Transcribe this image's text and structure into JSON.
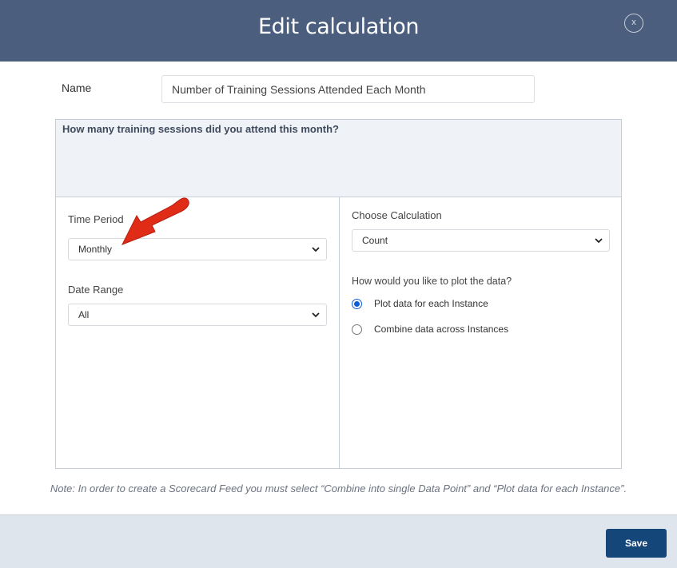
{
  "dialog": {
    "title": "Edit calculation",
    "close_label": "x"
  },
  "name": {
    "label": "Name",
    "value": "Number of Training Sessions Attended Each Month"
  },
  "question": "How many training sessions did you attend this month?",
  "left_panel": {
    "time_period": {
      "label": "Time Period",
      "value": "Monthly"
    },
    "date_range": {
      "label": "Date Range",
      "value": "All"
    }
  },
  "right_panel": {
    "calculation": {
      "label": "Choose Calculation",
      "value": "Count"
    },
    "plot_question": "How would you like to plot the data?",
    "plot_options": [
      {
        "label": "Plot data for each Instance",
        "checked": true
      },
      {
        "label": "Combine data across Instances",
        "checked": false
      }
    ]
  },
  "note": "Note: In order to create a Scorecard Feed you must select “Combine into single Data Point” and “Plot data for each Instance”.",
  "footer": {
    "save_label": "Save"
  },
  "colors": {
    "header": "#4b5e7e",
    "accent": "#15467a",
    "arrow": "#e02b17",
    "radio": "#0b5ed7"
  }
}
